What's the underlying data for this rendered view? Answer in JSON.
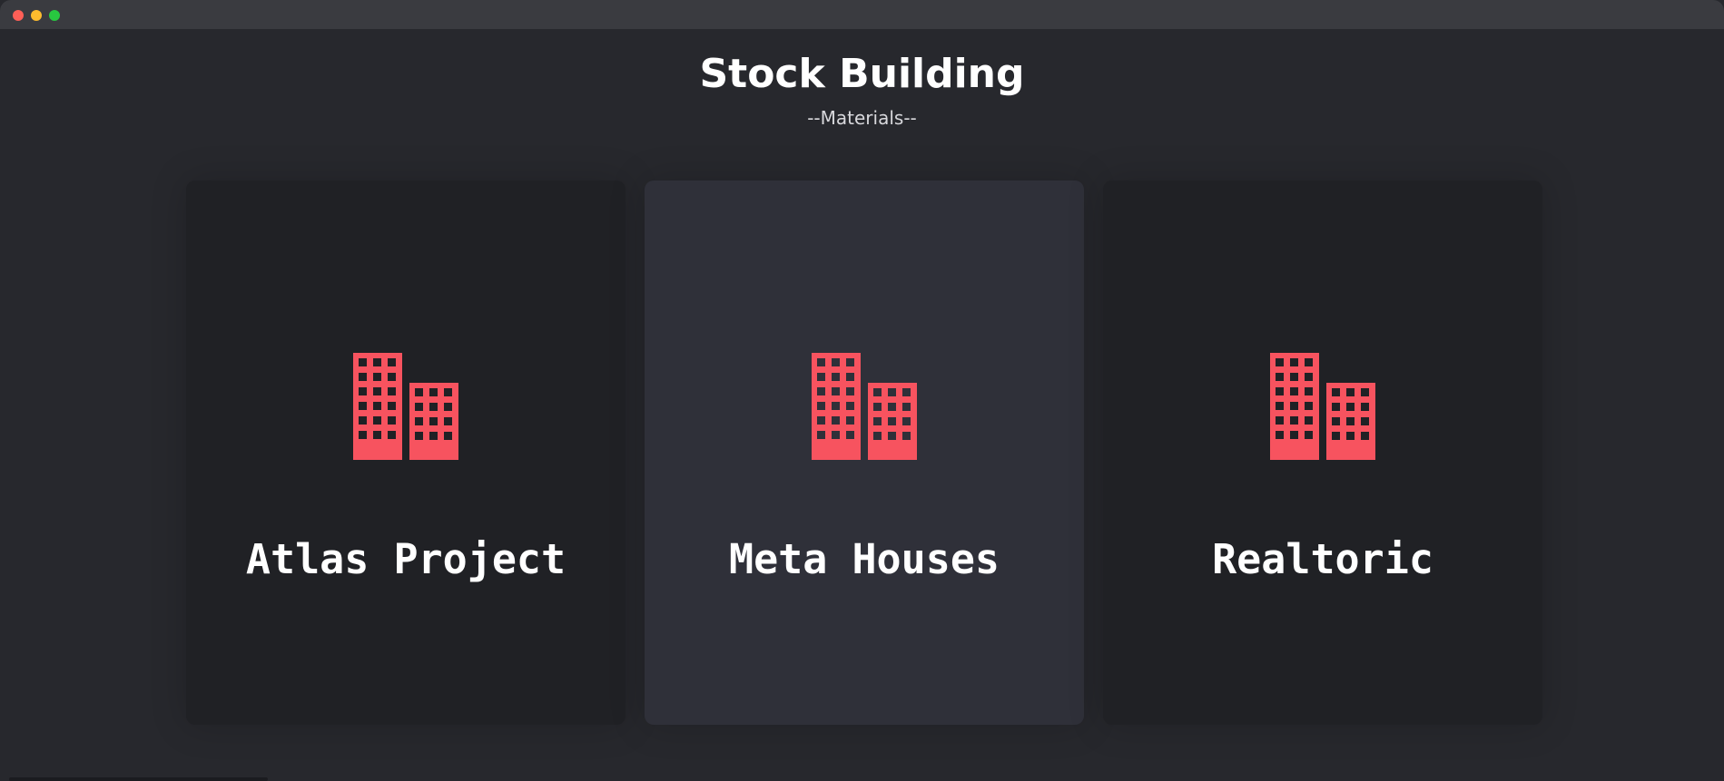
{
  "header": {
    "title": "Stock Building",
    "subtitle": "--Materials--"
  },
  "cards": [
    {
      "label": "Atlas Project",
      "icon": "buildings-icon",
      "active": false
    },
    {
      "label": "Meta Houses",
      "icon": "buildings-icon",
      "active": true
    },
    {
      "label": "Realtoric",
      "icon": "buildings-icon",
      "active": false
    }
  ],
  "colors": {
    "background": "#27282d",
    "card": "#202125",
    "card_active": "#2f3039",
    "accent": "#f7535f",
    "text": "#ffffff"
  }
}
